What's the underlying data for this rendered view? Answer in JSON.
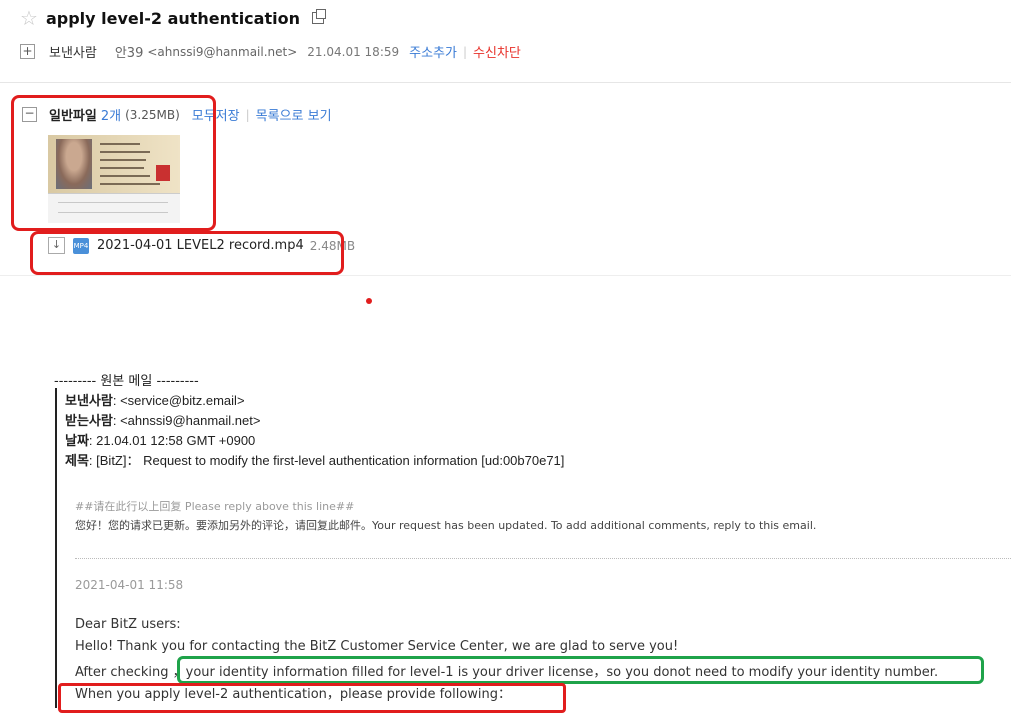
{
  "header": {
    "title": "apply level-2 authentication",
    "sender_label": "보낸사람",
    "sender_name": "안39",
    "sender_email": "<ahnssi9@hanmail.net>",
    "date": "21.04.01 18:59",
    "add_contact": "주소추가",
    "separator": "|",
    "block": "수신차단"
  },
  "attachments": {
    "toggle": "−",
    "type_label": "일반파일",
    "count": "2개",
    "total_size": "(3.25MB)",
    "save_all": "모두저장",
    "separator": "|",
    "view_list": "목록으로 보기",
    "file": {
      "icon_text": "MP4",
      "name": "2021-04-01 LEVEL2 record.mp4",
      "size": "2.48MB"
    }
  },
  "original": {
    "title": "--------- 원본 메일 ---------",
    "from_label": "보낸사람",
    "from_value": ": <service@bitz.email>",
    "to_label": "받는사람",
    "to_value": ": <ahnssi9@hanmail.net>",
    "date_label": "날짜",
    "date_value": ": 21.04.01 12:58 GMT +0900",
    "subject_label": "제목",
    "subject_value": ": [BitZ]： Request to modify the first-level authentication information [ud:00b70e71]",
    "reply_marker": "##请在此行以上回复 Please reply above this line##",
    "notice": "您好！您的请求已更新。要添加另外的评论，请回复此邮件。Your request has been updated. To add additional comments, reply to this email.",
    "timestamp": "2021-04-01 11:58",
    "body": [
      "Dear BitZ users:",
      "Hello! Thank you for contacting the BitZ Customer Service Center, we are glad to serve you!",
      "After checking ，your identity information filled for level-1 is your driver license，so you donot need to modify your identity number.",
      "When you apply level-2 authentication，please provide following："
    ]
  },
  "colors": {
    "annotation_red": "#e11d1d",
    "annotation_green": "#1fa34a",
    "link_blue": "#3a7bd5",
    "block_red": "#e8322b"
  }
}
